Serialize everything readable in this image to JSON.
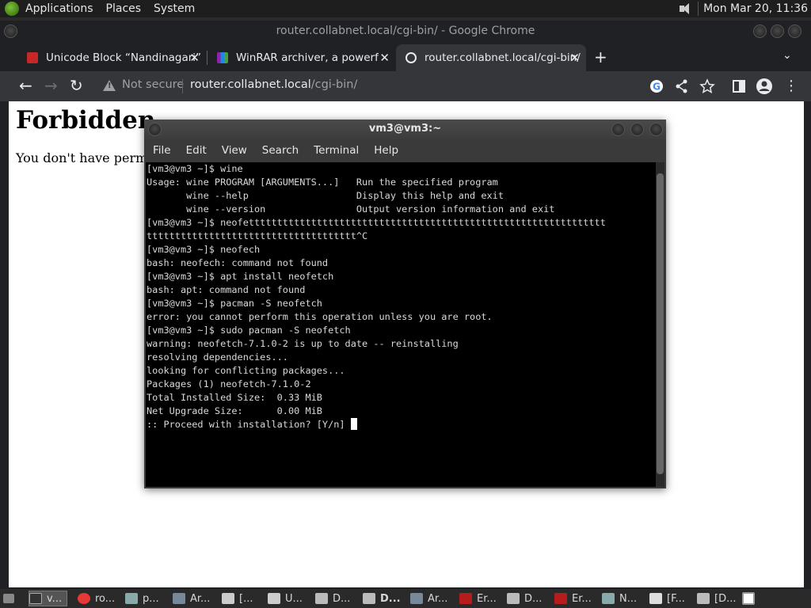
{
  "top_panel": {
    "menus": [
      "Applications",
      "Places",
      "System"
    ],
    "clock": "Mon Mar 20, 11:36"
  },
  "chrome": {
    "window_title": "router.collabnet.local/cgi-bin/ - Google Chrome",
    "tabs": [
      {
        "title": "Unicode Block “Nandinagari”",
        "favicon_color": "#c62828"
      },
      {
        "title": "WinRAR archiver, a powerful t",
        "favicon_color": "#8e24aa"
      },
      {
        "title": "router.collabnet.local/cgi-bin/",
        "favicon": "globe-icon"
      }
    ],
    "new_tab": "+",
    "not_secure": "Not secure",
    "url_host": "router.collabnet.local",
    "url_path": "/cgi-bin/"
  },
  "page": {
    "heading": "Forbidden",
    "message": "You don't have permissio"
  },
  "terminal": {
    "title": "vm3@vm3:~",
    "menu": [
      "File",
      "Edit",
      "View",
      "Search",
      "Terminal",
      "Help"
    ],
    "lines": [
      "[vm3@vm3 ~]$ wine",
      "Usage: wine PROGRAM [ARGUMENTS...]   Run the specified program",
      "       wine --help                   Display this help and exit",
      "       wine --version                Output version information and exit",
      "[vm3@vm3 ~]$ neofettttttttttttttttttttttttttttttttttttttttttttttttttttttttttttttt",
      "ttttttttttttttttttttttttttttttttttttt^C",
      "[vm3@vm3 ~]$ neofech",
      "bash: neofech: command not found",
      "[vm3@vm3 ~]$ apt install neofetch",
      "bash: apt: command not found",
      "[vm3@vm3 ~]$ pacman -S neofetch",
      "error: you cannot perform this operation unless you are root.",
      "[vm3@vm3 ~]$ sudo pacman -S neofetch",
      "warning: neofetch-7.1.0-2 is up to date -- reinstalling",
      "resolving dependencies...",
      "looking for conflicting packages...",
      "",
      "Packages (1) neofetch-7.1.0-2",
      "",
      "Total Installed Size:  0.33 MiB",
      "Net Upgrade Size:      0.00 MiB",
      "",
      ":: Proceed with installation? [Y/n] "
    ]
  },
  "taskbar": {
    "items": [
      {
        "label": "v...",
        "icon": "terminal-icon"
      },
      {
        "label": "ro...",
        "icon": "chrome-icon"
      },
      {
        "label": "p...",
        "icon": "wine-app-icon"
      },
      {
        "label": "Ar...",
        "icon": "archive-icon"
      },
      {
        "label": "[...",
        "icon": "document-icon"
      },
      {
        "label": "U...",
        "icon": "document-icon"
      },
      {
        "label": "D...",
        "icon": "folder-icon"
      },
      {
        "label": "D...",
        "icon": "folder-icon"
      },
      {
        "label": "Ar...",
        "icon": "archive-icon"
      },
      {
        "label": "Er...",
        "icon": "wine-glass-icon"
      },
      {
        "label": "D...",
        "icon": "folder-icon"
      },
      {
        "label": "Er...",
        "icon": "wine-glass-icon"
      },
      {
        "label": "N...",
        "icon": "wine-app-icon"
      },
      {
        "label": "[F...",
        "icon": "font-icon"
      },
      {
        "label": "[D...",
        "icon": "folder-icon"
      }
    ]
  }
}
